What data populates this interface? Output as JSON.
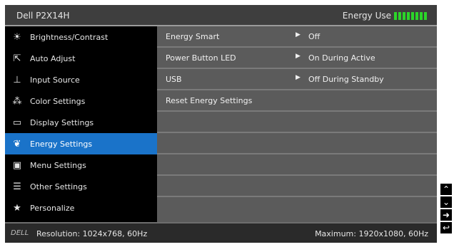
{
  "osd": {
    "model": "Dell P2X14H",
    "energy_label": "Energy Use",
    "energy_bars": 8
  },
  "sidebar": {
    "items": [
      {
        "label": "Brightness/Contrast",
        "icon": "sun-icon"
      },
      {
        "label": "Auto Adjust",
        "icon": "auto-adjust-icon"
      },
      {
        "label": "Input Source",
        "icon": "input-source-icon"
      },
      {
        "label": "Color Settings",
        "icon": "palette-icon"
      },
      {
        "label": "Display Settings",
        "icon": "display-icon"
      },
      {
        "label": "Energy Settings",
        "icon": "energy-icon",
        "active": true
      },
      {
        "label": "Menu Settings",
        "icon": "menu-icon"
      },
      {
        "label": "Other Settings",
        "icon": "other-settings-icon"
      },
      {
        "label": "Personalize",
        "icon": "star-icon"
      }
    ]
  },
  "panel": {
    "rows": [
      {
        "label": "Energy Smart",
        "value": "Off"
      },
      {
        "label": "Power Button LED",
        "value": "On During Active"
      },
      {
        "label": "USB",
        "value": "Off During Standby"
      },
      {
        "label": "Reset Energy Settings",
        "value": ""
      }
    ]
  },
  "status": {
    "logo": "DELL",
    "resolution": "Resolution: 1024x768, 60Hz",
    "maximum": "Maximum: 1920x1080, 60Hz"
  },
  "nav_buttons": [
    "up",
    "down",
    "right",
    "back"
  ]
}
